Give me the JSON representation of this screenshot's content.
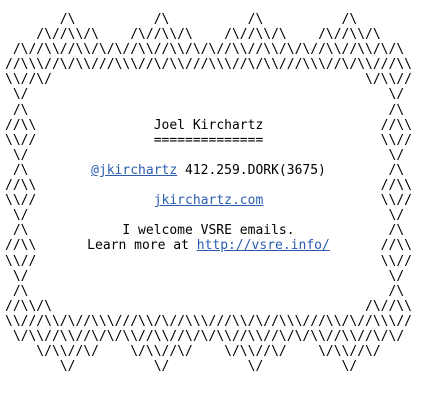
{
  "colors": {
    "text": "#000000",
    "link": "#2a5db0",
    "background": "#ffffff"
  },
  "rows": [
    {
      "art": "       /\\          /\\          /\\          /\\"
    },
    {
      "art": "    /\\//\\\\/\\    /\\//\\\\/\\    /\\//\\\\/\\    /\\//\\\\/\\"
    },
    {
      "art": " /\\//\\\\//\\\\/\\/\\//\\\\//\\\\/\\/\\//\\\\//\\\\/\\/\\//\\\\//\\\\/\\/\\"
    },
    {
      "art": "//\\\\\\//\\/\\\\///\\\\\\//\\/\\\\///\\\\\\//\\/\\\\///\\\\\\//\\/\\\\///\\\\"
    },
    {
      "art": "\\\\//\\/                                        \\/\\\\//"
    },
    {
      "left": " \\/",
      "right": " \\/"
    },
    {
      "left": " /\\",
      "right": " /\\"
    },
    {
      "left": "//\\\\",
      "right": "//\\\\",
      "content": [
        {
          "text": "Joel Kirchartz"
        }
      ]
    },
    {
      "left": "\\\\//",
      "right": "\\\\//",
      "content": [
        {
          "text": "=============="
        }
      ]
    },
    {
      "left": " \\/",
      "right": " \\/"
    },
    {
      "left": " /\\",
      "right": " /\\",
      "content": [
        {
          "link": "@jkirchartz"
        },
        {
          "text": " 412.259.DORK(3675)"
        }
      ]
    },
    {
      "left": "//\\\\",
      "right": "//\\\\"
    },
    {
      "left": "\\\\//",
      "right": "\\\\//",
      "content": [
        {
          "link": "jkirchartz.com"
        }
      ]
    },
    {
      "left": " \\/",
      "right": " \\/"
    },
    {
      "left": " /\\",
      "right": " /\\",
      "content": [
        {
          "text": "I welcome VSRE emails."
        }
      ]
    },
    {
      "left": "//\\\\",
      "right": "//\\\\",
      "content": [
        {
          "text": "Learn more at "
        },
        {
          "link": "http://vsre.info/"
        }
      ]
    },
    {
      "left": "\\\\//",
      "right": "\\\\//"
    },
    {
      "left": " \\/",
      "right": " \\/"
    },
    {
      "left": " /\\",
      "right": " /\\"
    },
    {
      "art": "//\\\\/\\                                        /\\//\\\\"
    },
    {
      "art": "\\\\///\\\\/\\//\\\\\\///\\\\/\\//\\\\\\///\\\\/\\//\\\\\\///\\\\/\\//\\\\\\//"
    },
    {
      "art": " \\/\\\\//\\\\//\\/\\/\\\\//\\\\//\\/\\/\\\\//\\\\//\\/\\/\\\\//\\\\//\\/\\/"
    },
    {
      "art": "    \\/\\\\//\\/    \\/\\\\//\\/    \\/\\\\//\\/    \\/\\\\//\\/"
    },
    {
      "art": "       \\/          \\/          \\/          \\/"
    }
  ]
}
